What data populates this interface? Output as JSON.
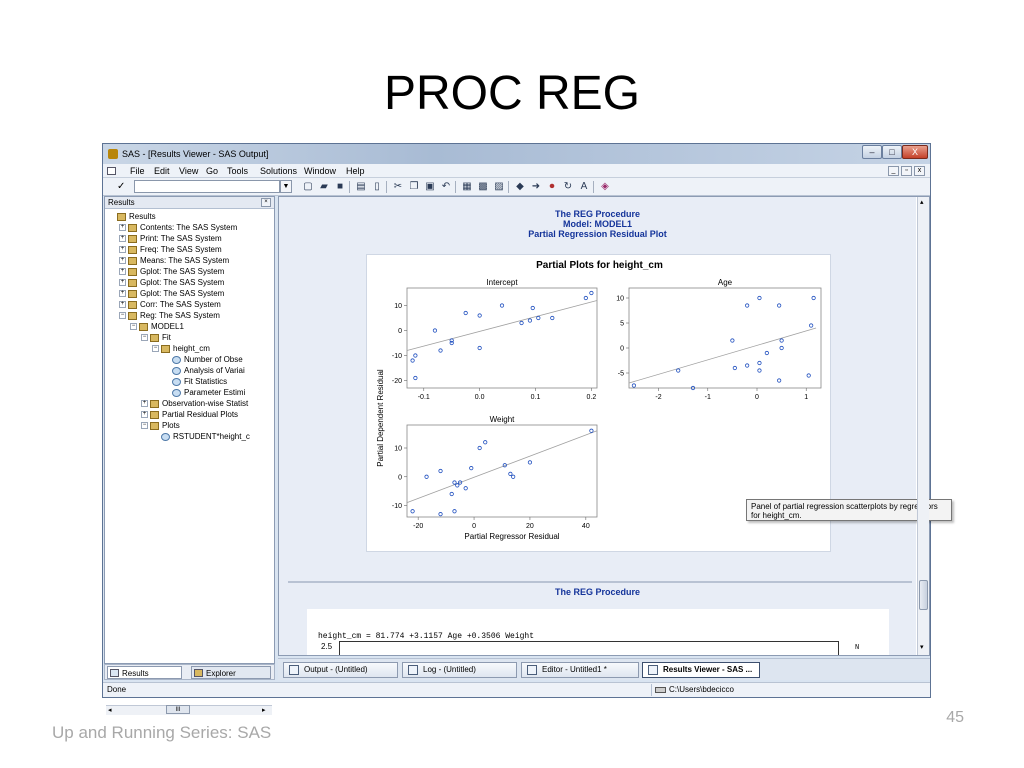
{
  "slide": {
    "title": "PROC REG",
    "footer": "Up and Running Series: SAS",
    "page_number": "45"
  },
  "window": {
    "title": "SAS - [Results Viewer - SAS Output]",
    "min_glyph": "–",
    "max_glyph": "□",
    "close_glyph": "X"
  },
  "menu": {
    "items": [
      "File",
      "Edit",
      "View",
      "Go",
      "Tools",
      "Solutions",
      "Window",
      "Help"
    ],
    "mdi_min": "_",
    "mdi_max": "▫",
    "mdi_close": "x"
  },
  "toolbar": {
    "command_check": "✓",
    "command_value": "",
    "dropdown_glyph": "▼"
  },
  "results_pane": {
    "header": "Results",
    "close_glyph": "×",
    "tree": [
      {
        "label": "Results",
        "depth": 0,
        "exp": "",
        "icon": "folder"
      },
      {
        "label": "Contents:  The SAS System",
        "depth": 1,
        "exp": "+",
        "icon": "folder"
      },
      {
        "label": "Print:  The SAS System",
        "depth": 1,
        "exp": "+",
        "icon": "folder"
      },
      {
        "label": "Freq:  The SAS System",
        "depth": 1,
        "exp": "+",
        "icon": "folder"
      },
      {
        "label": "Means:  The SAS System",
        "depth": 1,
        "exp": "+",
        "icon": "folder"
      },
      {
        "label": "Gplot:  The SAS System",
        "depth": 1,
        "exp": "+",
        "icon": "folder"
      },
      {
        "label": "Gplot:  The SAS System",
        "depth": 1,
        "exp": "+",
        "icon": "folder"
      },
      {
        "label": "Gplot:  The SAS System",
        "depth": 1,
        "exp": "+",
        "icon": "folder"
      },
      {
        "label": "Corr:  The SAS System",
        "depth": 1,
        "exp": "+",
        "icon": "folder"
      },
      {
        "label": "Reg:  The SAS System",
        "depth": 1,
        "exp": "−",
        "icon": "folder"
      },
      {
        "label": "MODEL1",
        "depth": 2,
        "exp": "−",
        "icon": "folder"
      },
      {
        "label": "Fit",
        "depth": 3,
        "exp": "−",
        "icon": "folder"
      },
      {
        "label": "height_cm",
        "depth": 4,
        "exp": "−",
        "icon": "folder"
      },
      {
        "label": "Number of Obse",
        "depth": 5,
        "exp": "",
        "icon": "doc"
      },
      {
        "label": "Analysis of Variai",
        "depth": 5,
        "exp": "",
        "icon": "doc"
      },
      {
        "label": "Fit Statistics",
        "depth": 5,
        "exp": "",
        "icon": "doc"
      },
      {
        "label": "Parameter Estimi",
        "depth": 5,
        "exp": "",
        "icon": "doc"
      },
      {
        "label": "Observation-wise Statist",
        "depth": 3,
        "exp": "+",
        "icon": "folder"
      },
      {
        "label": "Partial Residual Plots",
        "depth": 3,
        "exp": "+",
        "icon": "folder"
      },
      {
        "label": "Plots",
        "depth": 3,
        "exp": "−",
        "icon": "folder"
      },
      {
        "label": "RSTUDENT*height_c",
        "depth": 4,
        "exp": "",
        "icon": "doc"
      }
    ],
    "tabs": [
      "Results",
      "Explorer"
    ],
    "scroll_mark": "III"
  },
  "viewer": {
    "proc_title": "The REG Procedure",
    "model_title": "Model: MODEL1",
    "plot_caption": "Partial Regression Residual Plot",
    "plot_panel_title": "Partial Plots for height_cm",
    "second_proc_title": "The REG Procedure",
    "equation": "height_cm = 81.774 +3.1157 Age +0.3506 Weight",
    "eq_ylabel": "2.5",
    "eq_n": "N",
    "tooltip": "Panel of partial regression scatterplots by regressors for height_cm."
  },
  "chart_data": [
    {
      "type": "scatter",
      "title": "Intercept",
      "xlabel": "",
      "ylabel": "",
      "xlim": [
        -0.13,
        0.21
      ],
      "ylim": [
        -23,
        17
      ],
      "xticks": [
        -0.1,
        0.0,
        0.1,
        0.2
      ],
      "xtick_labels": [
        "-0.1",
        "0.0",
        "0.1",
        "0.2"
      ],
      "yticks": [
        -20,
        -10,
        0,
        10
      ],
      "ytick_labels": [
        "-20",
        "-10",
        "0",
        "10"
      ],
      "points": [
        [
          -0.12,
          -12
        ],
        [
          -0.115,
          -10
        ],
        [
          -0.115,
          -19
        ],
        [
          -0.08,
          0
        ],
        [
          -0.07,
          -8
        ],
        [
          -0.05,
          -4
        ],
        [
          -0.05,
          -5
        ],
        [
          -0.025,
          7
        ],
        [
          0.0,
          6
        ],
        [
          0.0,
          -7
        ],
        [
          0.04,
          10
        ],
        [
          0.075,
          3
        ],
        [
          0.09,
          4
        ],
        [
          0.095,
          9
        ],
        [
          0.105,
          5
        ],
        [
          0.13,
          5
        ],
        [
          0.19,
          13
        ],
        [
          0.2,
          15
        ]
      ],
      "fit": [
        [
          -0.13,
          -8
        ],
        [
          0.21,
          12
        ]
      ],
      "grid": false
    },
    {
      "type": "scatter",
      "title": "Age",
      "xlabel": "",
      "ylabel": "",
      "xlim": [
        -2.6,
        1.3
      ],
      "ylim": [
        -8,
        12
      ],
      "xticks": [
        -2,
        -1,
        0,
        1
      ],
      "xtick_labels": [
        "-2",
        "-1",
        "0",
        "1"
      ],
      "yticks": [
        -5,
        0,
        5,
        10
      ],
      "ytick_labels": [
        "-5",
        "0",
        "5",
        "10"
      ],
      "points": [
        [
          -2.5,
          -7.5
        ],
        [
          -1.6,
          -4.5
        ],
        [
          -1.3,
          -8
        ],
        [
          -0.5,
          1.5
        ],
        [
          -0.45,
          -4
        ],
        [
          -0.2,
          8.5
        ],
        [
          -0.2,
          -3.5
        ],
        [
          0.05,
          10
        ],
        [
          0.05,
          -3
        ],
        [
          0.05,
          -4.5
        ],
        [
          0.2,
          -1
        ],
        [
          0.45,
          -6.5
        ],
        [
          0.45,
          8.5
        ],
        [
          0.5,
          1.5
        ],
        [
          0.5,
          0
        ],
        [
          1.05,
          -5.5
        ],
        [
          1.1,
          4.5
        ],
        [
          1.15,
          10
        ]
      ],
      "fit": [
        [
          -2.6,
          -7
        ],
        [
          1.2,
          4
        ]
      ],
      "grid": false
    },
    {
      "type": "scatter",
      "title": "Weight",
      "xlabel": "Partial Regressor Residual",
      "ylabel": "Partial Dependent Residual",
      "xlim": [
        -24,
        44
      ],
      "ylim": [
        -14,
        18
      ],
      "xticks": [
        -20,
        0,
        20,
        40
      ],
      "xtick_labels": [
        "-20",
        "0",
        "20",
        "40"
      ],
      "yticks": [
        -10,
        0,
        10
      ],
      "ytick_labels": [
        "-10",
        "0",
        "10"
      ],
      "points": [
        [
          -22,
          -12
        ],
        [
          -17,
          0
        ],
        [
          -12,
          2
        ],
        [
          -12,
          -13
        ],
        [
          -8,
          -6
        ],
        [
          -7,
          -2
        ],
        [
          -7,
          -12
        ],
        [
          -6,
          -3
        ],
        [
          -5,
          -2
        ],
        [
          -3,
          -4
        ],
        [
          -1,
          3
        ],
        [
          2,
          10
        ],
        [
          4,
          12
        ],
        [
          11,
          4
        ],
        [
          13,
          1
        ],
        [
          14,
          0
        ],
        [
          20,
          5
        ],
        [
          42,
          16
        ]
      ],
      "fit": [
        [
          -24,
          -9
        ],
        [
          44,
          16
        ]
      ],
      "grid": false
    }
  ],
  "taskbar": {
    "tabs": [
      "Output - (Untitled)",
      "Log - (Untitled)",
      "Editor - Untitled1 *",
      "Results Viewer - SAS ..."
    ]
  },
  "statusbar": {
    "left": "Done",
    "path": "C:\\Users\\bdecicco"
  },
  "colors": {
    "proc_blue": "#14349a",
    "point_blue": "#1f4fbf",
    "fit_line": "#a0a0a0"
  }
}
